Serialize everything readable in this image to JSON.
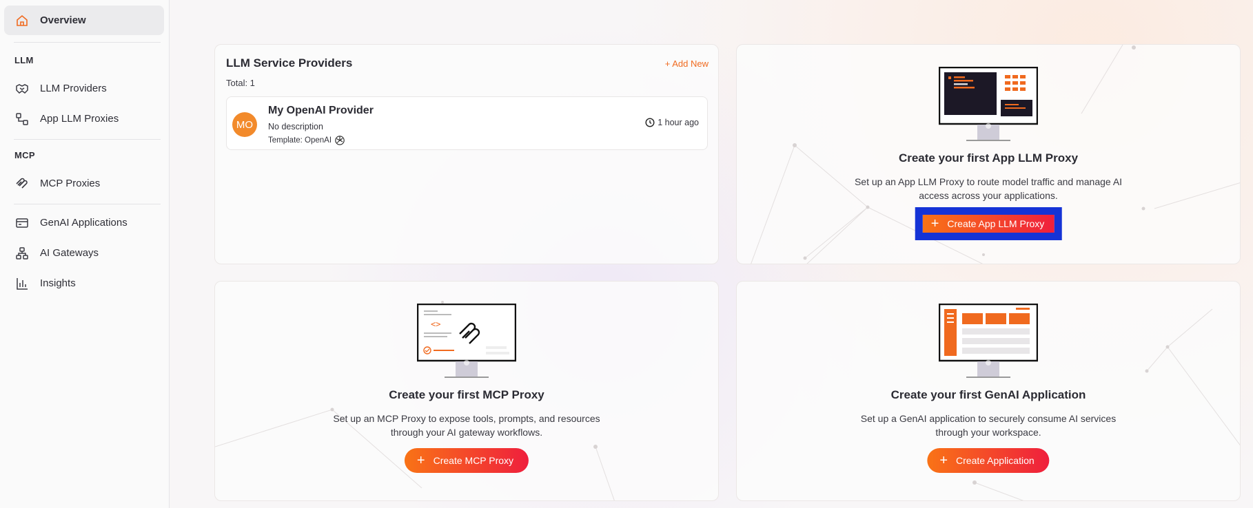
{
  "sidebar": {
    "overview": "Overview",
    "llm_section": "LLM",
    "llm_providers": "LLM Providers",
    "app_llm_proxies": "App LLM Proxies",
    "mcp_section": "MCP",
    "mcp_proxies": "MCP Proxies",
    "genai_applications": "GenAI Applications",
    "ai_gateways": "AI Gateways",
    "insights": "Insights"
  },
  "providers_card": {
    "title": "LLM Service Providers",
    "total": "Total: 1",
    "add_new": "+ Add New",
    "items": [
      {
        "initials": "MO",
        "name": "My OpenAI Provider",
        "description": "No description",
        "template": "Template: OpenAI",
        "time": "1 hour ago"
      }
    ]
  },
  "proxy_card": {
    "title": "Create your first App LLM Proxy",
    "description": "Set up an App LLM Proxy to route model traffic and manage AI access across your applications.",
    "button": "Create App LLM Proxy"
  },
  "mcp_card": {
    "title": "Create your first MCP Proxy",
    "description": "Set up an MCP Proxy to expose tools, prompts, and resources through your AI gateway workflows.",
    "button": "Create MCP Proxy"
  },
  "app_card": {
    "title": "Create your first GenAI Application",
    "description": "Set up a GenAI application to securely consume AI services through your workspace.",
    "button": "Create Application"
  },
  "colors": {
    "accent": "#f06a1f",
    "button_gradient_start": "#f97316",
    "button_gradient_end": "#ef1f3d",
    "focus_ring": "#1533d6"
  }
}
